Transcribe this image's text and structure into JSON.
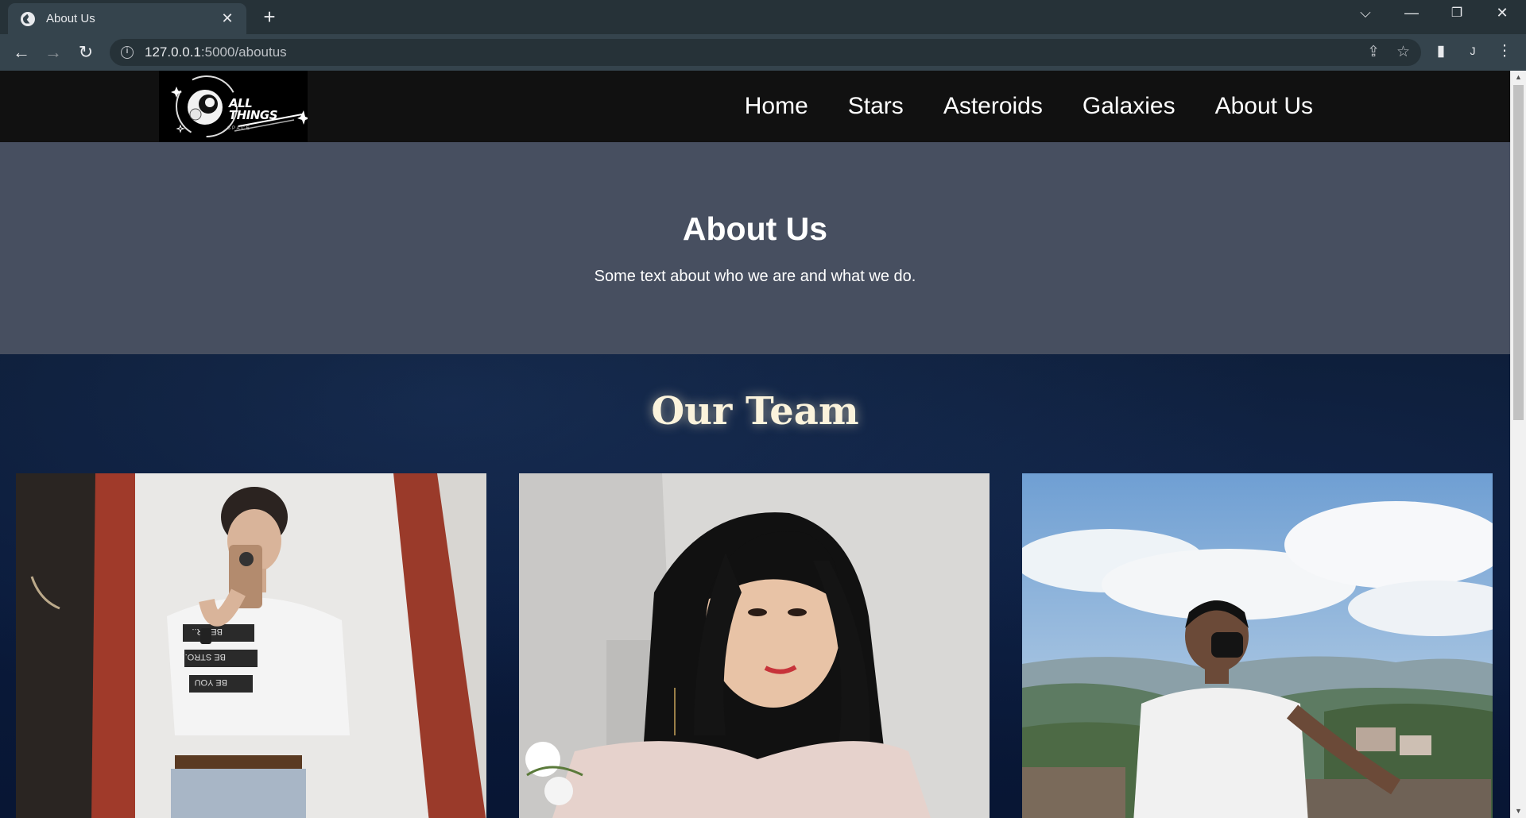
{
  "browser": {
    "tab_title": "About Us",
    "tab_close": "✕",
    "new_tab": "+",
    "url_host": "127.0.0.1",
    "url_path": ":5000/aboutus",
    "profile_initial": "J"
  },
  "header": {
    "logo_text_line1": "ALL",
    "logo_text_line2": "THINGS",
    "logo_sub": "SPACE",
    "nav": [
      "Home",
      "Stars",
      "Asteroids",
      "Galaxies",
      "About Us"
    ]
  },
  "about": {
    "title": "About Us",
    "text": "Some text about who we are and what we do."
  },
  "team": {
    "title": "Our Team",
    "members": [
      {
        "photo": "mirror-selfie",
        "shirt_text": [
          "BE FR..",
          "BE STRO..",
          "BE YOU"
        ]
      },
      {
        "photo": "portrait-woman"
      },
      {
        "photo": "mountain-view"
      }
    ]
  },
  "colors": {
    "header_bg": "#111111",
    "hero_bg": "#474f60",
    "team_bg": "#0a1a3a",
    "team_title": "#fbf3dc"
  }
}
